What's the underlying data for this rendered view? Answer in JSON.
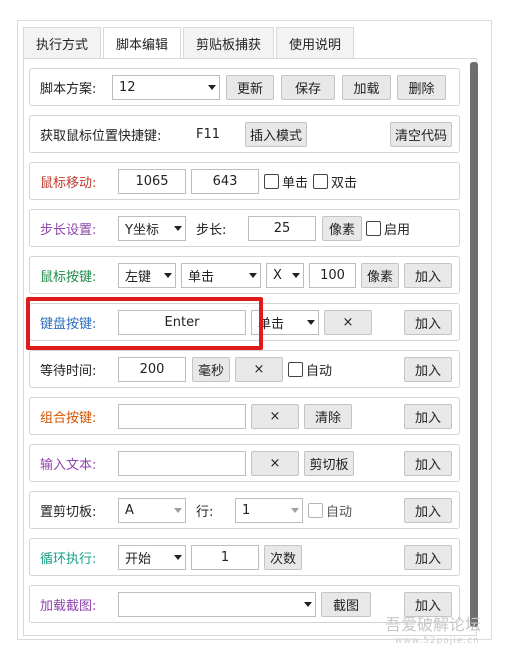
{
  "tabs": [
    {
      "label": "执行方式",
      "active": false
    },
    {
      "label": "脚本编辑",
      "active": true
    },
    {
      "label": "剪贴板捕获",
      "active": false
    },
    {
      "label": "使用说明",
      "active": false
    }
  ],
  "script_row": {
    "label": "脚本方案:",
    "selected": "12",
    "update": "更新",
    "save": "保存",
    "load": "加载",
    "delete": "删除"
  },
  "hotkey_row": {
    "label": "获取鼠标位置快捷键:",
    "key": "F11",
    "insert_mode": "插入模式",
    "clear_code": "清空代码"
  },
  "mouse_move_row": {
    "label": "鼠标移动:",
    "x": "1065",
    "y": "643",
    "single": "单击",
    "double": "双击"
  },
  "step_row": {
    "label": "步长设置:",
    "axis": "Y坐标",
    "step_label": "步长:",
    "step": "25",
    "unit": "像素",
    "enable": "启用"
  },
  "mouse_button_row": {
    "label": "鼠标按键:",
    "button": "左键",
    "click": "单击",
    "axis": "X",
    "value": "100",
    "unit": "像素",
    "add": "加入"
  },
  "keyboard_row": {
    "label": "键盘按键:",
    "key": "Enter",
    "click": "单击",
    "clear": "×",
    "add": "加入"
  },
  "wait_row": {
    "label": "等待时间:",
    "value": "200",
    "unit": "毫秒",
    "clear": "×",
    "auto": "自动",
    "add": "加入"
  },
  "combo_row": {
    "label": "组合按键:",
    "value": "",
    "clear": "×",
    "clear_btn": "清除",
    "add": "加入"
  },
  "text_row": {
    "label": "输入文本:",
    "value": "",
    "clear": "×",
    "clipboard": "剪切板",
    "add": "加入"
  },
  "clipboard_row": {
    "label": "置剪切板:",
    "value": "A",
    "line_label": "行:",
    "line": "1",
    "auto": "自动",
    "add": "加入"
  },
  "loop_row": {
    "label": "循环执行:",
    "mode": "开始",
    "count": "1",
    "unit": "次数",
    "add": "加入"
  },
  "screenshot_row": {
    "label": "加载截图:",
    "value": "",
    "capture": "截图",
    "add": "加入"
  },
  "watermark": {
    "main": "吾爱破解论坛",
    "sub": "www.52pojie.cn"
  }
}
